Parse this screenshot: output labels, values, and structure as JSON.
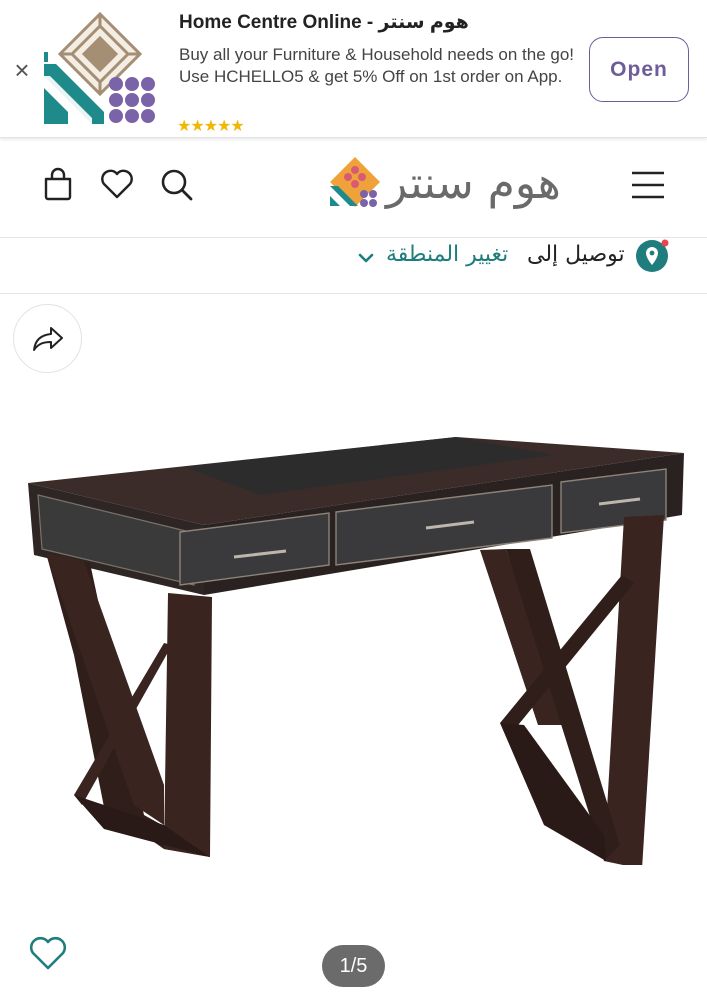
{
  "banner": {
    "close_label": "×",
    "app_logo_icon": "home-centre-app-logo",
    "title": "Home Centre Online - هوم سنتر",
    "description": "Buy all your Furniture & Household needs on the go! Use HCHELLO5 & get 5% Off on 1st order on App.",
    "rating_stars": "★★★★★",
    "rating": 5,
    "open_label": "Open"
  },
  "header": {
    "brand_name": "هوم سنتر",
    "icons": [
      "bag-icon",
      "heart-icon",
      "search-icon",
      "menu-icon"
    ]
  },
  "delivery": {
    "label": "توصيل إلى",
    "change_link": "تغيير المنطقة",
    "icon": "location-pin-icon"
  },
  "gallery": {
    "pager": "1/5",
    "current_image": 1,
    "total_images": 5,
    "product": "desk-with-x-legs-and-three-drawers"
  },
  "colors": {
    "accent_purple": "#6f5c9a",
    "teal": "#1f7d7d",
    "star_yellow": "#f2b705",
    "pager_bg": "#6b6b6b"
  }
}
